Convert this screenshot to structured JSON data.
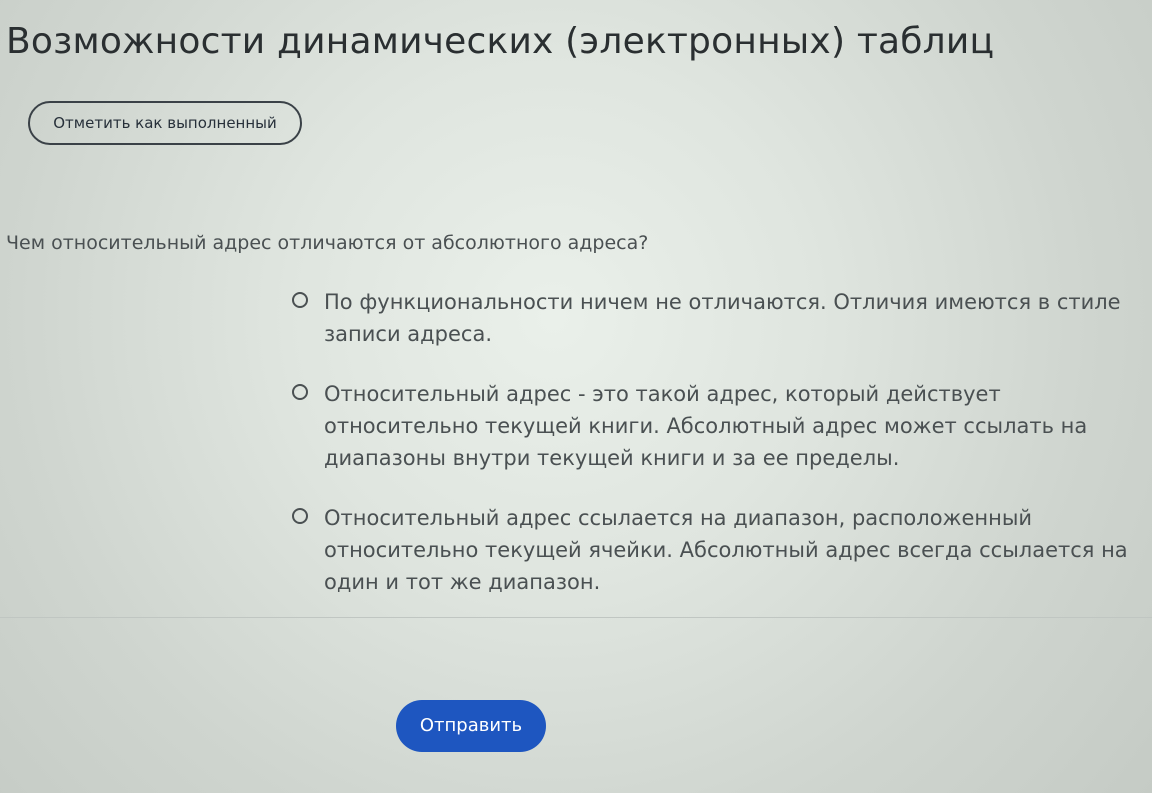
{
  "page": {
    "title": "Возможности динамических (электронных) таблиц",
    "mark_done_label": "Отметить как выполненный"
  },
  "quiz": {
    "question": "Чем относительный адрес отличаются от абсолютного адреса?",
    "options": [
      {
        "label": "По функциональности ничем не отличаются. Отличия имеются в стиле записи адреса.",
        "selected": false
      },
      {
        "label": "Относительный адрес - это такой адрес, который действует относительно текущей книги. Абсолютный адрес может ссылать на диапазоны внутри текущей книги и за ее пределы.",
        "selected": false
      },
      {
        "label": "Относительный адрес ссылается на диапазон, расположенный относительно текущей ячейки. Абсолютный адрес всегда ссылается на один и тот же диапазон.",
        "selected": false
      }
    ],
    "submit_label": "Отправить"
  },
  "colors": {
    "primary_button": "#1e56c0",
    "text": "#4a5052"
  },
  "icons": {
    "radio": "radio-unchecked-icon"
  }
}
